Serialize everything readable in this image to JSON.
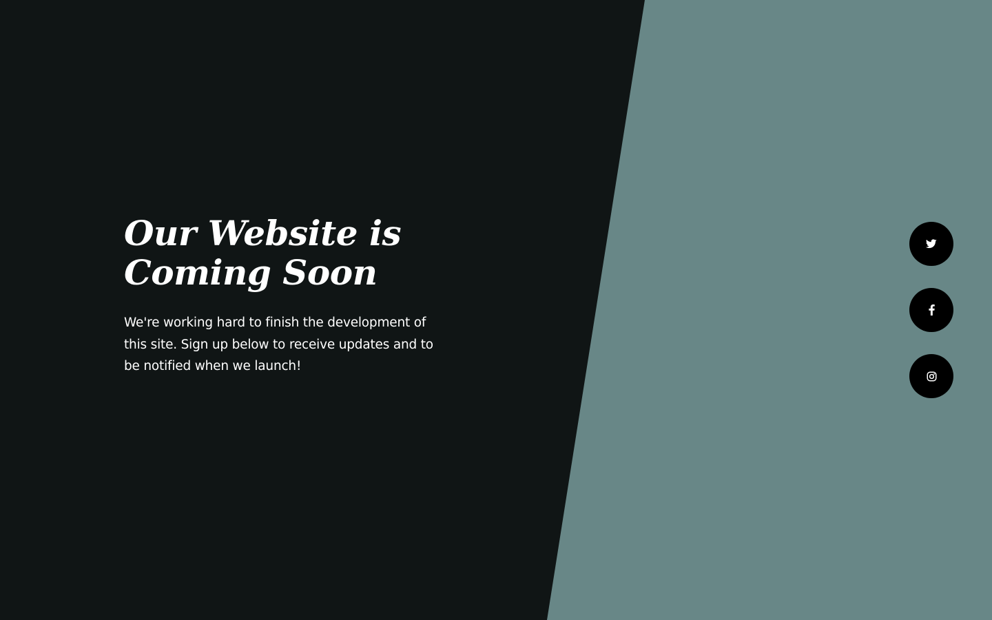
{
  "hero": {
    "title": "Our Website is\nComing Soon",
    "description": "We're working hard to finish the development of this site. Sign up below to receive updates and to be notified when we launch!"
  },
  "social": [
    {
      "icon": "twitter-icon"
    },
    {
      "icon": "facebook-icon"
    },
    {
      "icon": "instagram-icon"
    }
  ],
  "colors": {
    "background_dark": "#101515",
    "panel_accent": "#688787",
    "text": "#ffffff",
    "button": "#000000"
  }
}
